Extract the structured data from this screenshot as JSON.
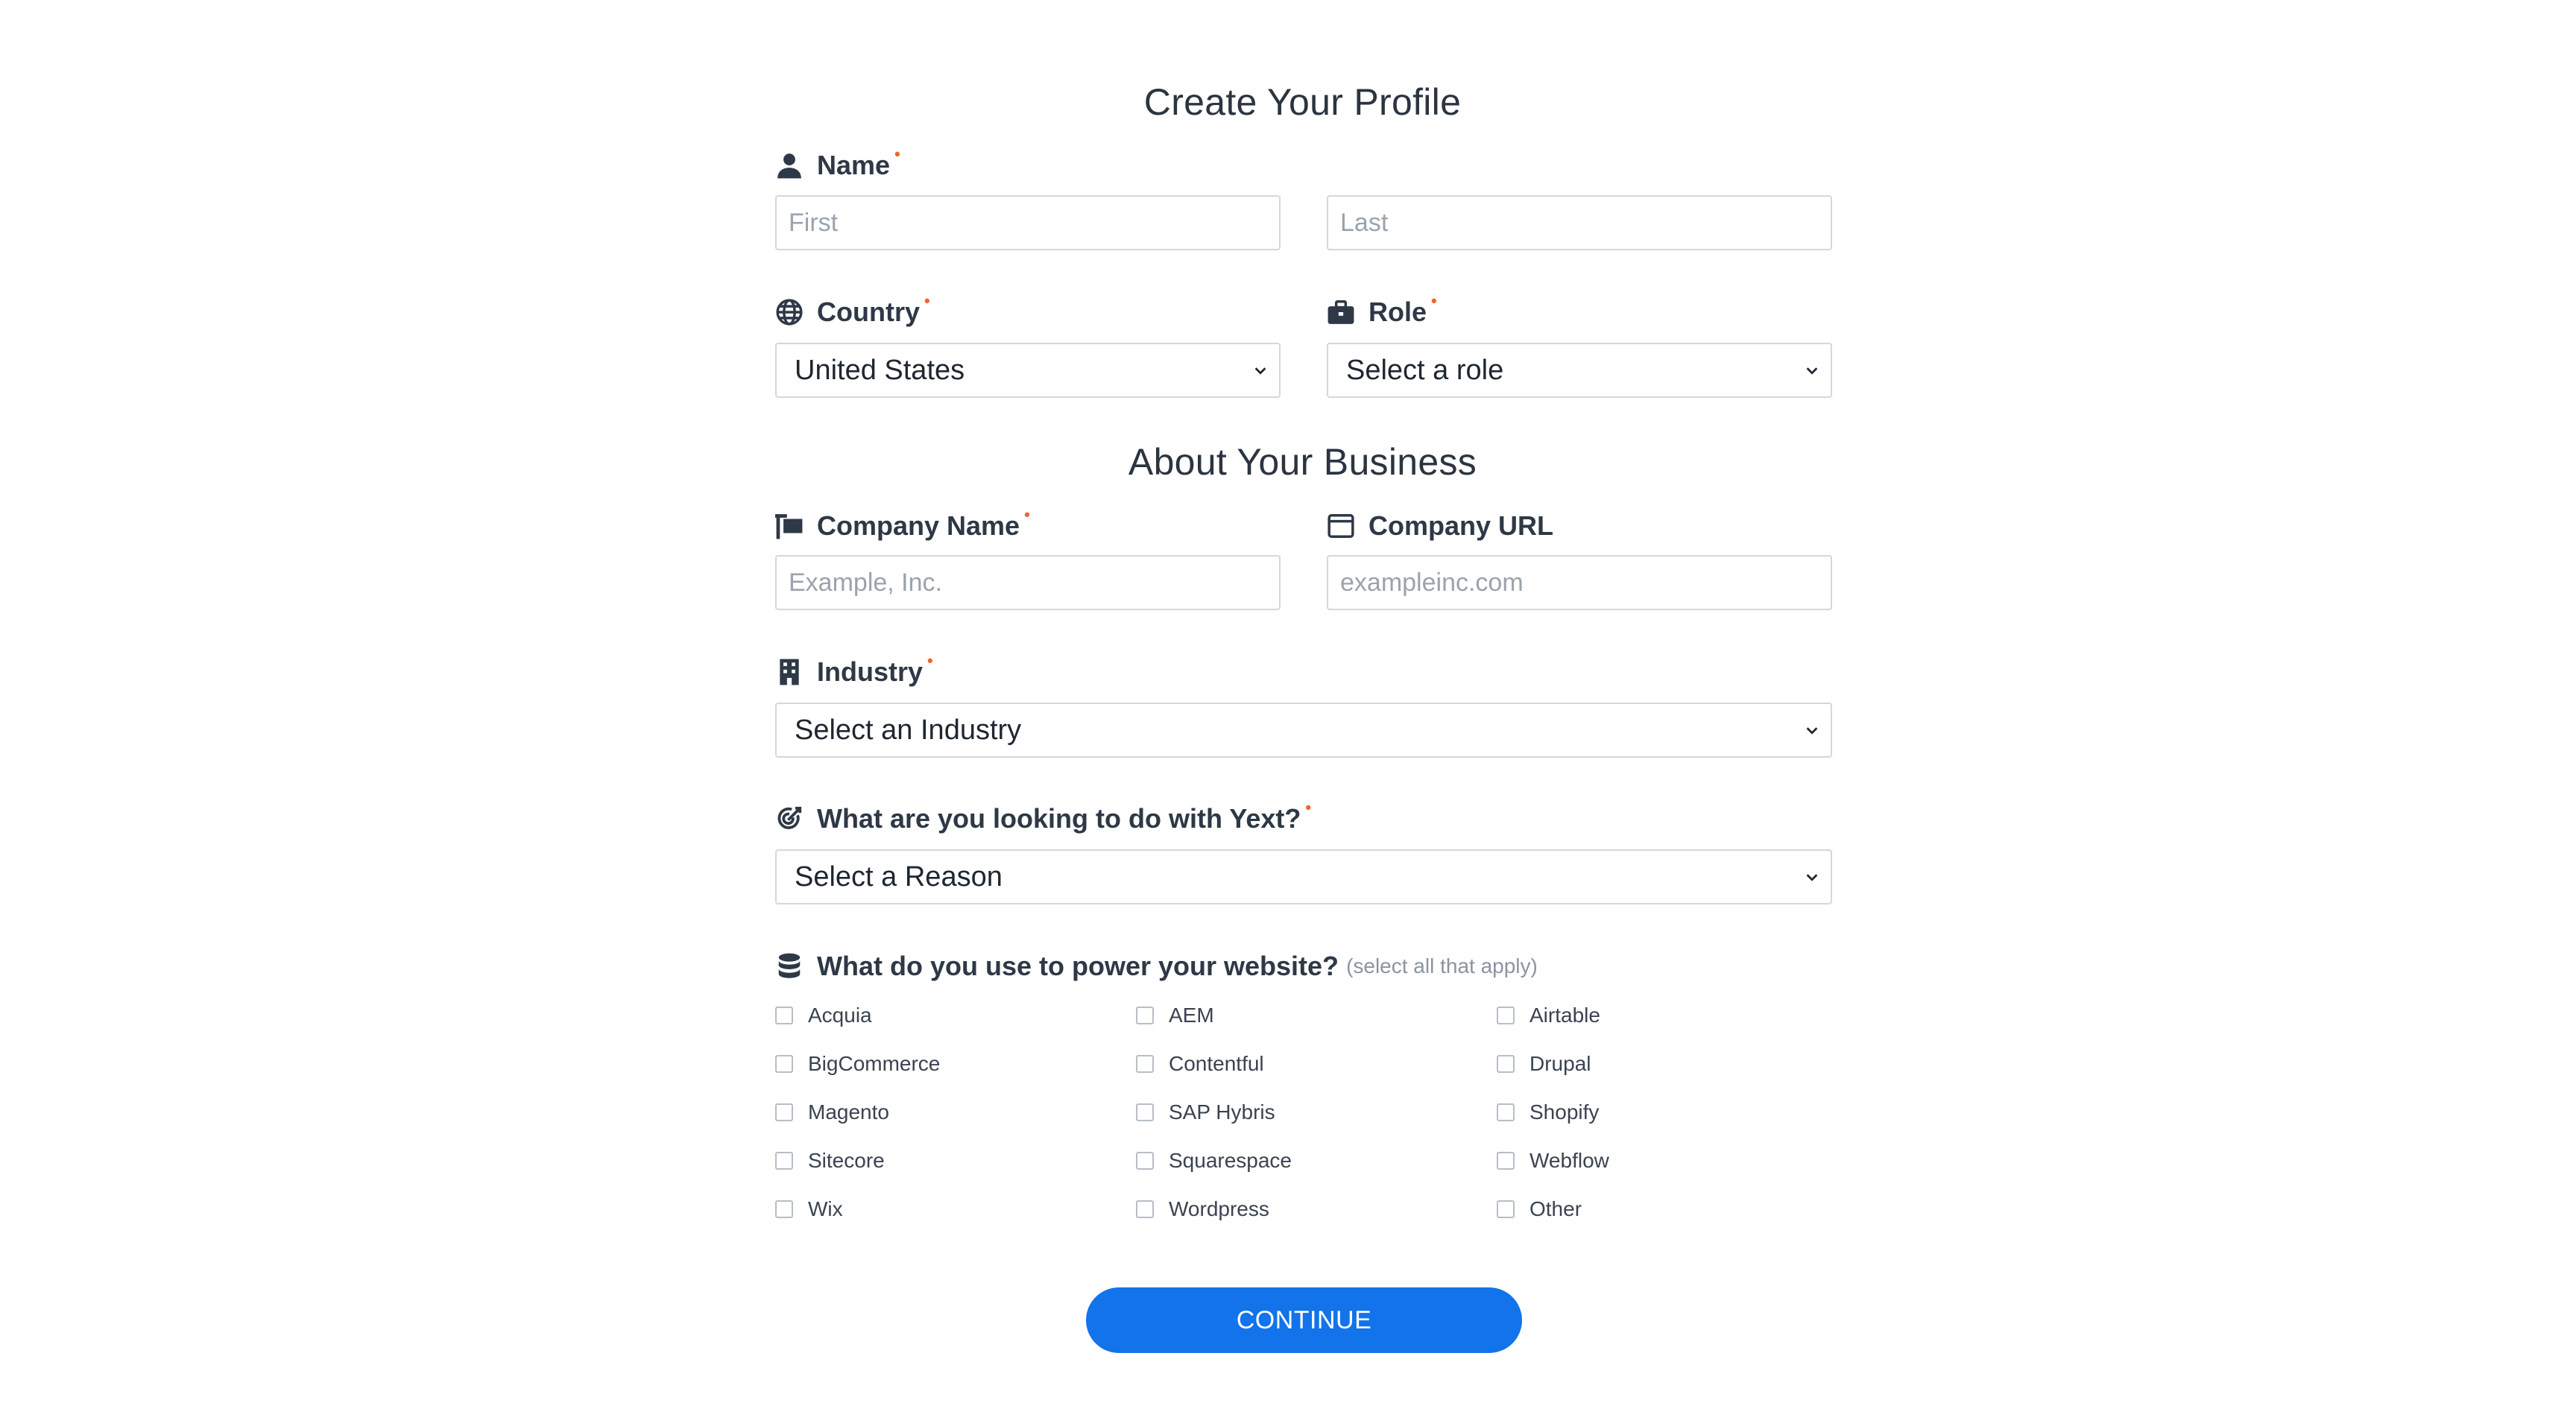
{
  "section1_title": "Create Your Profile",
  "section2_title": "About Your Business",
  "name": {
    "label": "Name",
    "first_placeholder": "First",
    "last_placeholder": "Last",
    "required": "•"
  },
  "country": {
    "label": "Country",
    "value": "United States",
    "required": "•"
  },
  "role": {
    "label": "Role",
    "value": "Select a role",
    "required": "•"
  },
  "company_name": {
    "label": "Company Name",
    "placeholder": "Example, Inc.",
    "required": "•"
  },
  "company_url": {
    "label": "Company URL",
    "placeholder": "exampleinc.com"
  },
  "industry": {
    "label": "Industry",
    "value": "Select an Industry",
    "required": "•"
  },
  "reason": {
    "label": "What are you looking to do with Yext?",
    "value": "Select a Reason",
    "required": "•"
  },
  "platforms": {
    "label": "What do you use to power your website?",
    "hint": "(select all that apply)",
    "options": [
      "Acquia",
      "AEM",
      "Airtable",
      "BigCommerce",
      "Contentful",
      "Drupal",
      "Magento",
      "SAP Hybris",
      "Shopify",
      "Sitecore",
      "Squarespace",
      "Webflow",
      "Wix",
      "Wordpress",
      "Other"
    ]
  },
  "continue_label": "CONTINUE",
  "colors": {
    "accent": "#1273ea",
    "required": "#f0642d"
  }
}
